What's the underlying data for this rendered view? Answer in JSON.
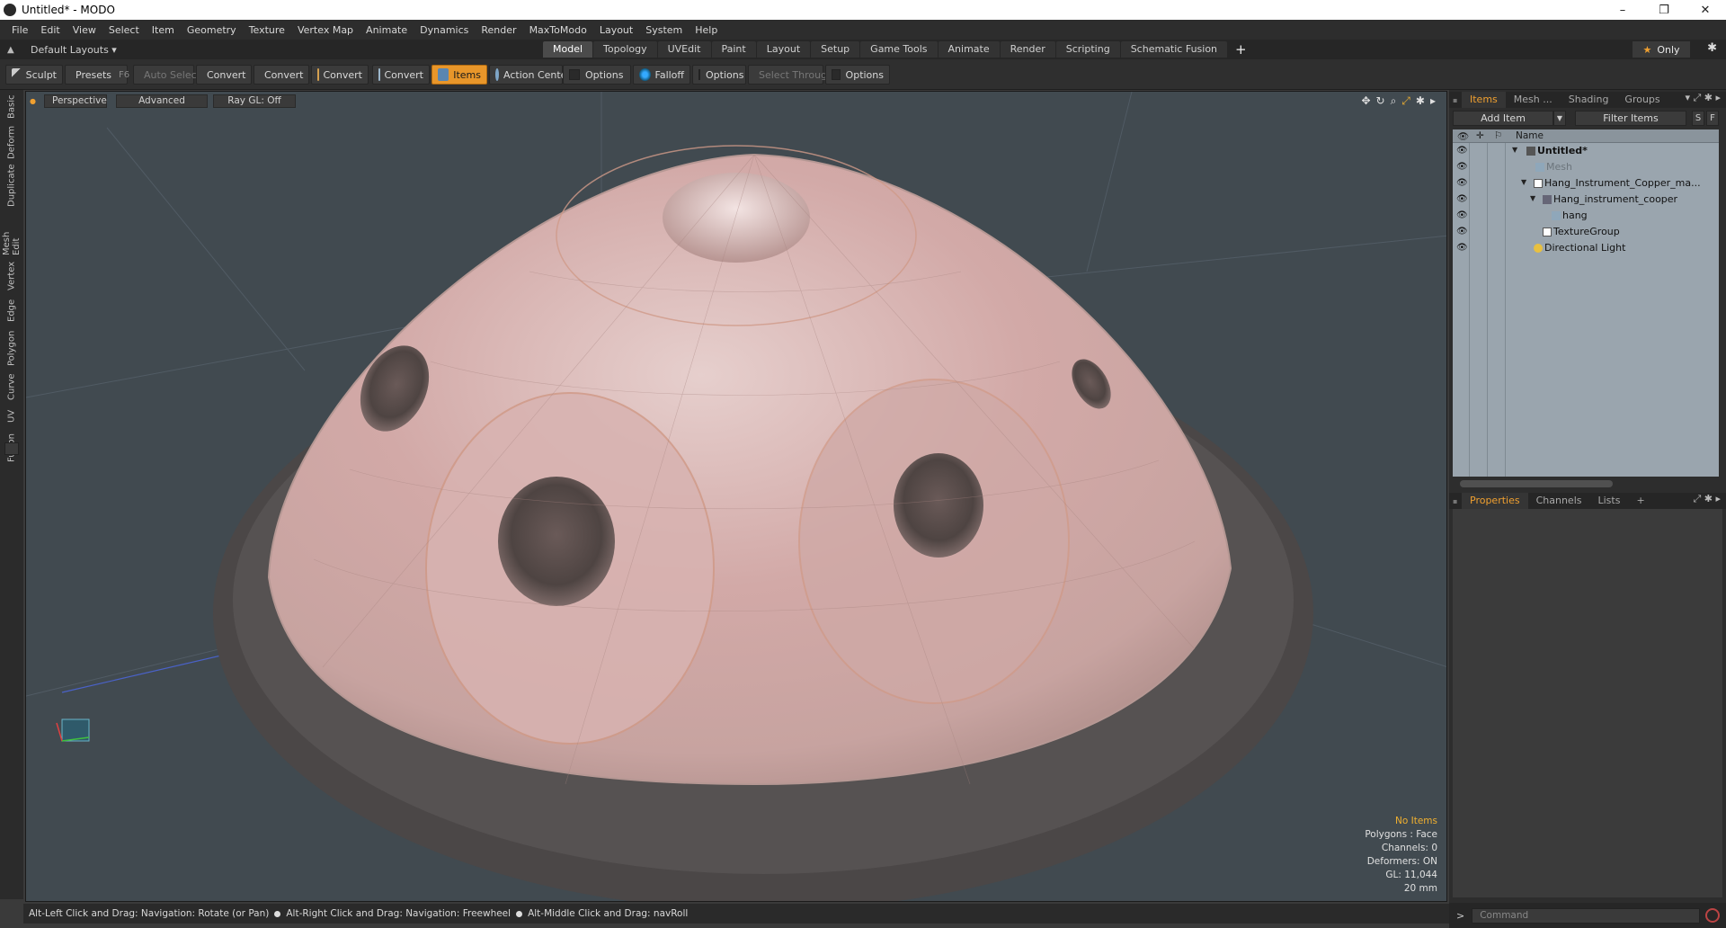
{
  "window": {
    "title": "Untitled* - MODO",
    "controls": [
      "–",
      "❐",
      "✕"
    ]
  },
  "menubar": {
    "items": [
      "File",
      "Edit",
      "View",
      "Select",
      "Item",
      "Geometry",
      "Texture",
      "Vertex Map",
      "Animate",
      "Dynamics",
      "Render",
      "MaxToModo",
      "Layout",
      "System",
      "Help"
    ]
  },
  "layoutbar": {
    "layouts_label": "Default Layouts ▾",
    "tabs": [
      "Model",
      "Topology",
      "UVEdit",
      "Paint",
      "Layout",
      "Setup",
      "Game Tools",
      "Animate",
      "Render",
      "Scripting",
      "Schematic Fusion"
    ],
    "active_tab": "Model",
    "plus": "+",
    "only_label": "Only",
    "star": "★",
    "gear": "✱"
  },
  "toolbar": {
    "sculpt": "Sculpt",
    "presets": "Presets",
    "presets_key": "F6",
    "auto_select": "Auto Select",
    "convert": "Convert",
    "items": "Items",
    "action_center": "Action Center",
    "options": "Options",
    "falloff": "Falloff",
    "select_through": "Select Through"
  },
  "left_tabs": [
    "Basic",
    "Deform",
    "Duplicate",
    "Mesh Edit",
    "Vertex",
    "Edge",
    "Polygon",
    "Curve",
    "UV",
    "Fusion"
  ],
  "viewport": {
    "view_mode": "Perspective",
    "advanced": "Advanced",
    "raygl": "Ray GL: Off",
    "info": {
      "selection": "No Items",
      "polygons": "Polygons : Face",
      "channels": "Channels: 0",
      "deformers": "Deformers: ON",
      "gl": "GL: 11,044",
      "scale": "20 mm"
    }
  },
  "statusbar": {
    "hint1": "Alt-Left Click and Drag: Navigation: Rotate (or Pan)",
    "hint2": "Alt-Right Click and Drag: Navigation: Freewheel",
    "hint3": "Alt-Middle Click and Drag: navRoll"
  },
  "items_panel": {
    "tabs": [
      "Items",
      "Mesh ...",
      "Shading",
      "Groups"
    ],
    "active_tab": "Items",
    "add_item": "Add Item",
    "filter_items": "Filter Items",
    "s_btn": "S",
    "f_btn": "F",
    "name_header": "Name",
    "tree": [
      {
        "label": "Untitled*",
        "depth": 0,
        "bold": true
      },
      {
        "label": "Mesh",
        "depth": 1,
        "dim": true
      },
      {
        "label": "Hang_Instrument_Copper_ma...",
        "depth": 1
      },
      {
        "label": "Hang_instrument_cooper",
        "depth": 2
      },
      {
        "label": "hang",
        "depth": 3
      },
      {
        "label": "TextureGroup",
        "depth": 2
      },
      {
        "label": "Directional Light",
        "depth": 1
      }
    ]
  },
  "properties_panel": {
    "tabs": [
      "Properties",
      "Channels",
      "Lists"
    ],
    "active_tab": "Properties",
    "plus": "+"
  },
  "commandbar": {
    "prompt": ">",
    "placeholder": "Command"
  }
}
